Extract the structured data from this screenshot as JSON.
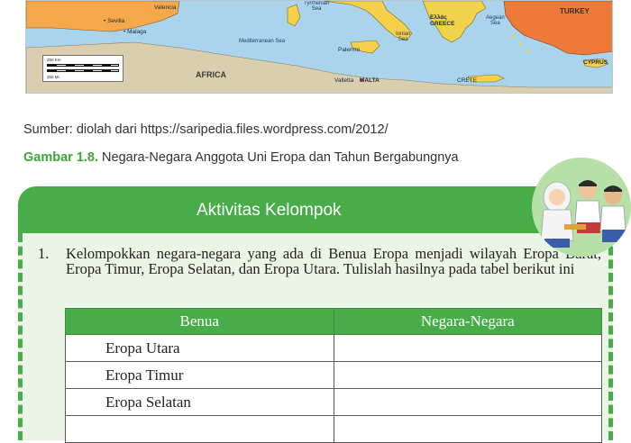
{
  "map": {
    "labels": {
      "sevilla": "• Sevilla",
      "malaga": "• Malaga",
      "valencia": "Valencia",
      "tyrrhenian": "Tyrrhenian\nSea",
      "mediterranean": "Mediterranean Sea",
      "ionian": "Ionian\nSea",
      "aegean": "Aegean\nSea",
      "greece": "Ελλάς\nGREECE",
      "palermo": "Palermo",
      "crete": "CRETE",
      "valletta": "Valletta",
      "malta": "MALTA",
      "africa": "AFRICA",
      "turkey": "TURKEY",
      "cyprus": "CYPRUS",
      "scale_km": "250 Km",
      "scale_mi": "250 Mi."
    },
    "colors": {
      "sea": "#a9d4ec",
      "spain": "#f5a94a",
      "italy": "#f6d04a",
      "greece": "#f2d24b",
      "turkey": "#ee7a3a",
      "africa": "#d9cfae"
    }
  },
  "source": "Sumber: diolah dari https://saripedia.files.wordpress.com/2012/",
  "caption": {
    "figure": "Gambar 1.8.",
    "text": " Negara-Negara Anggota Uni Eropa dan Tahun Bergabungnya"
  },
  "activity": {
    "title": "Aktivitas Kelompok",
    "item_number": "1.",
    "item_text": "Kelompokkan negara-negara yang ada di Benua Eropa menjadi wilayah Eropa Barat, Eropa Timur, Eropa Selatan, dan Eropa Utara. Tulislah hasilnya pada tabel berikut ini",
    "table": {
      "headers": [
        "Benua",
        "Negara-Negara"
      ],
      "rows": [
        [
          "Eropa Utara",
          ""
        ],
        [
          "Eropa Timur",
          ""
        ],
        [
          "Eropa Selatan",
          ""
        ],
        [
          "",
          ""
        ]
      ]
    },
    "colors": {
      "green": "#48ad48",
      "panel": "#eaf5e6"
    }
  }
}
